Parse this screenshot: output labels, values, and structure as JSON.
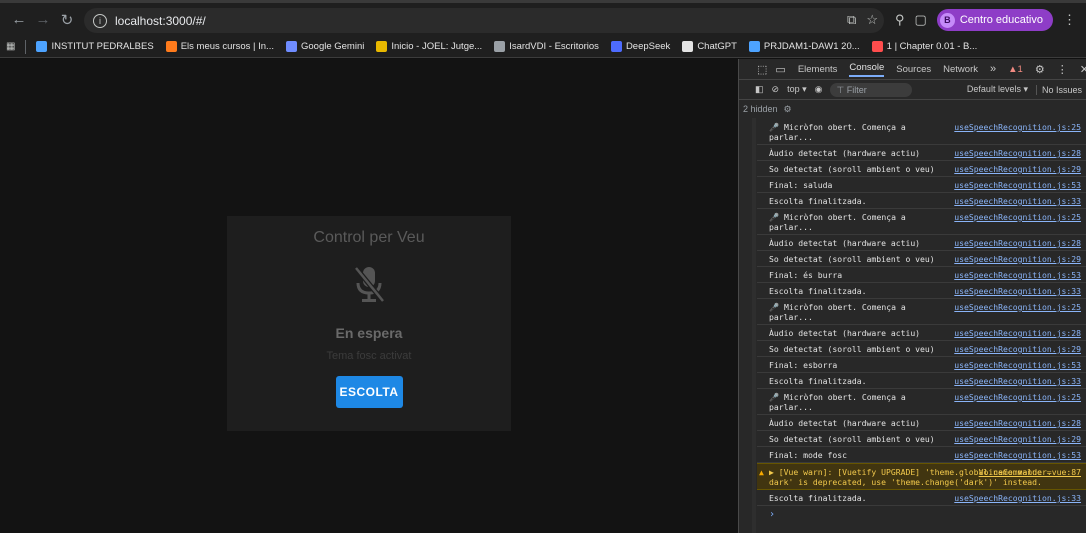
{
  "browser": {
    "url": "localhost:3000/#/",
    "profile_initial": "B",
    "profile_name": "Centro educativo",
    "bookmarks": [
      {
        "label": "INSTITUT PEDRALBES",
        "color": "#4da3ff"
      },
      {
        "label": "Els meus cursos | In...",
        "color": "#ff7b1c"
      },
      {
        "label": "Google Gemini",
        "color": "#6f8cff"
      },
      {
        "label": "Inicio - JOEL: Jutge...",
        "color": "#e8b800"
      },
      {
        "label": "IsardVDI - Escritorios",
        "color": "#9aa0a6"
      },
      {
        "label": "DeepSeek",
        "color": "#4d6bfe"
      },
      {
        "label": "ChatGPT",
        "color": "#e3e3e3"
      },
      {
        "label": "PRJDAM1-DAW1 20...",
        "color": "#4da3ff"
      },
      {
        "label": "1 | Chapter 0.01 - B...",
        "color": "#ff4d4d"
      }
    ]
  },
  "app": {
    "title": "Control per Veu",
    "status": "En espera",
    "theme_message": "Tema fosc activat",
    "listen_button": "ESCOLTA"
  },
  "devtools": {
    "tabs": [
      "Elements",
      "Console",
      "Sources",
      "Network"
    ],
    "active_tab": "Console",
    "warning_count": "1",
    "context": "top ▾",
    "filter_placeholder": "Filter",
    "levels": "Default levels ▾",
    "issues": "No Issues",
    "hidden": "2 hidden",
    "logs": [
      {
        "msg": "🎤 Micròfon obert. Comença a parlar...",
        "src": "useSpeechRecognition.js:25"
      },
      {
        "msg": "Àudio detectat (hardware actiu)",
        "src": "useSpeechRecognition.js:28"
      },
      {
        "msg": "So detectat (soroll ambient o veu)",
        "src": "useSpeechRecognition.js:29"
      },
      {
        "msg": "Final: saluda",
        "src": "useSpeechRecognition.js:53"
      },
      {
        "msg": "Escolta finalitzada.",
        "src": "useSpeechRecognition.js:33"
      },
      {
        "msg": "🎤 Micròfon obert. Comença a parlar...",
        "src": "useSpeechRecognition.js:25"
      },
      {
        "msg": "Àudio detectat (hardware actiu)",
        "src": "useSpeechRecognition.js:28"
      },
      {
        "msg": "So detectat (soroll ambient o veu)",
        "src": "useSpeechRecognition.js:29"
      },
      {
        "msg": "Final: és burra",
        "src": "useSpeechRecognition.js:53"
      },
      {
        "msg": "Escolta finalitzada.",
        "src": "useSpeechRecognition.js:33"
      },
      {
        "msg": "🎤 Micròfon obert. Comença a parlar...",
        "src": "useSpeechRecognition.js:25"
      },
      {
        "msg": "Àudio detectat (hardware actiu)",
        "src": "useSpeechRecognition.js:28"
      },
      {
        "msg": "So detectat (soroll ambient o veu)",
        "src": "useSpeechRecognition.js:29"
      },
      {
        "msg": "Final: esborra",
        "src": "useSpeechRecognition.js:53"
      },
      {
        "msg": "Escolta finalitzada.",
        "src": "useSpeechRecognition.js:33"
      },
      {
        "msg": "🎤 Micròfon obert. Comença a parlar...",
        "src": "useSpeechRecognition.js:25"
      },
      {
        "msg": "Àudio detectat (hardware actiu)",
        "src": "useSpeechRecognition.js:28"
      },
      {
        "msg": "So detectat (soroll ambient o veu)",
        "src": "useSpeechRecognition.js:29"
      },
      {
        "msg": "Final: mode fosc",
        "src": "useSpeechRecognition.js:53"
      }
    ],
    "warning": {
      "msg": "▶ [Vue warn]: [Vuetify UPGRADE] 'theme.global.name.value = dark' is deprecated, use 'theme.change('dark')' instead.",
      "src": "VoiceCommander.vue:87"
    },
    "last_log": {
      "msg": "Escolta finalitzada.",
      "src": "useSpeechRecognition.js:33"
    },
    "prompt": "›"
  }
}
